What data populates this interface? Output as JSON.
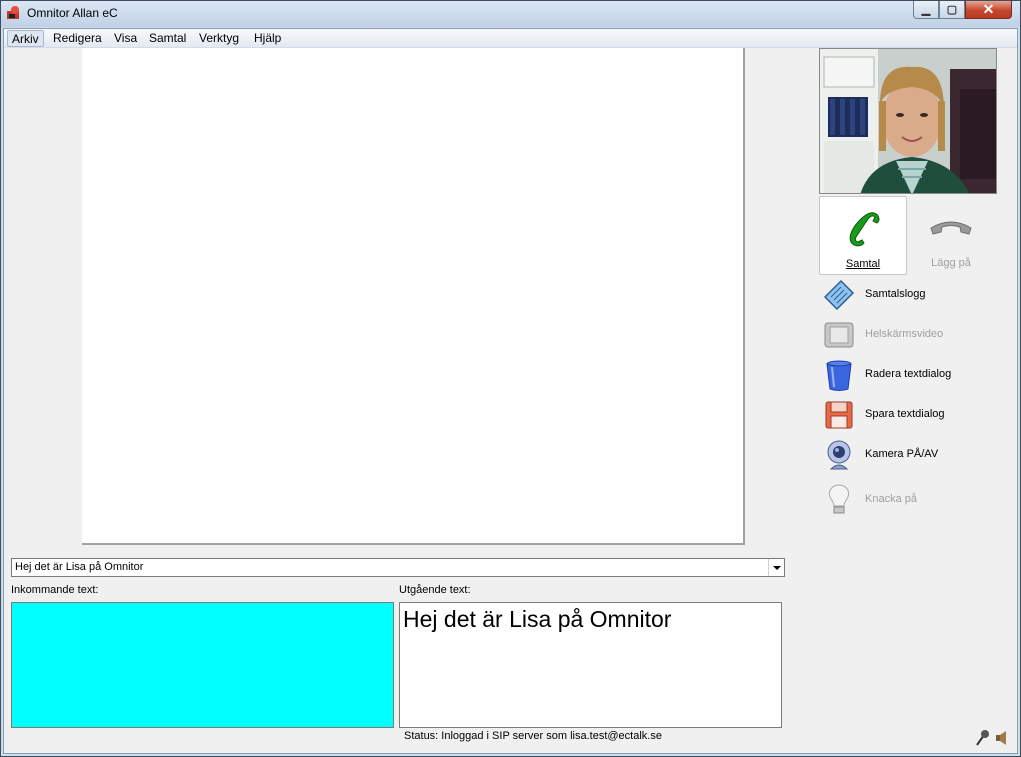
{
  "window": {
    "title": "Omnitor Allan eC"
  },
  "menu": [
    "Arkiv",
    "Redigera",
    "Visa",
    "Samtal",
    "Verktyg",
    "Hjälp"
  ],
  "combo": {
    "value": "Hej det är Lisa på Omnitor"
  },
  "labels": {
    "incoming": "Inkommande text:",
    "outgoing": "Utgående text:"
  },
  "outgoing_text": "Hej det är Lisa på Omnitor",
  "status": "Status: Inloggad i SIP server som lisa.test@ectalk.se",
  "call_buttons": {
    "call": "Samtal",
    "hangup": "Lägg på"
  },
  "side_actions": [
    {
      "label": "Samtalslogg",
      "icon": "notepad-icon",
      "enabled": true
    },
    {
      "label": "Helskärmsvideo",
      "icon": "monitor-icon",
      "enabled": false
    },
    {
      "label": "Radera textdialog",
      "icon": "trash-bin-icon",
      "enabled": true
    },
    {
      "label": "Spara textdialog",
      "icon": "floppy-disk-icon",
      "enabled": true
    },
    {
      "label": "Kamera PÅ/AV",
      "icon": "webcam-icon",
      "enabled": true
    },
    {
      "label": "Knacka på",
      "icon": "lightbulb-icon",
      "enabled": false
    }
  ],
  "colors": {
    "incoming_bg": "#00ffff",
    "call_green": "#1a9a1a",
    "hangup_gray": "#9a9a9a"
  }
}
